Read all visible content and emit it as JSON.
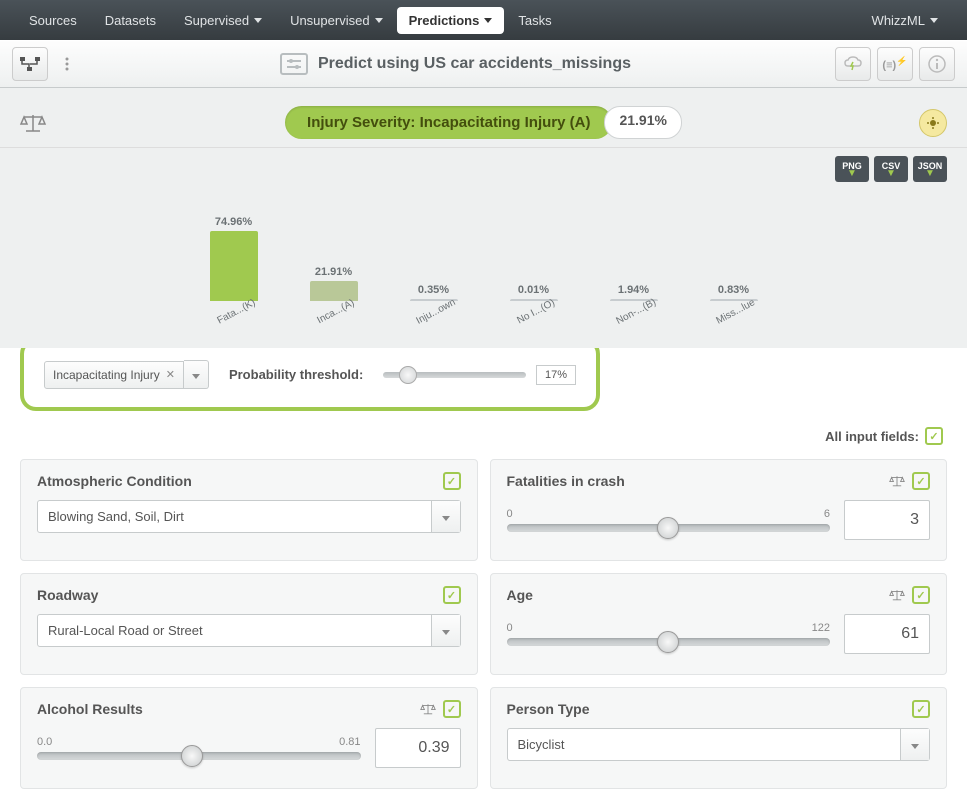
{
  "nav": {
    "items": [
      "Sources",
      "Datasets",
      "Supervised",
      "Unsupervised",
      "Predictions",
      "Tasks"
    ],
    "active": "Predictions",
    "right": "WhizzML"
  },
  "title": "Predict using US car accidents_missings",
  "prediction": {
    "label": "Injury Severity: Incapacitating Injury (A)",
    "pct": "21.91%"
  },
  "export_buttons": [
    "PNG",
    "CSV",
    "JSON"
  ],
  "chart_data": {
    "type": "bar",
    "categories": [
      "Fata...(K)",
      "Inca...(A)",
      "Inju...own",
      "No I...(O)",
      "Non-...(B)",
      "Miss...lue"
    ],
    "values": [
      74.96,
      21.91,
      0.35,
      0.01,
      1.94,
      0.83
    ],
    "labels": [
      "74.96%",
      "21.91%",
      "0.35%",
      "0.01%",
      "1.94%",
      "0.83%"
    ],
    "colors": [
      "#a0c94f",
      "#b9c898",
      "#c7cccf",
      "#c7cccf",
      "#c7cccf",
      "#c7cccf"
    ],
    "ylabel": "",
    "ylim": [
      0,
      100
    ]
  },
  "threshold": {
    "class": "Incapacitating Injury",
    "label": "Probability threshold:",
    "pct": "17%",
    "slider_pos": 17
  },
  "all_input_fields": "All input fields:",
  "fields": [
    {
      "title": "Atmospheric Condition",
      "type": "select",
      "value": "Blowing Sand, Soil, Dirt",
      "show_scale": false
    },
    {
      "title": "Fatalities in crash",
      "type": "slider",
      "min": "0",
      "max": "6",
      "value": "3",
      "slider_pos": 50,
      "show_scale": true
    },
    {
      "title": "Roadway",
      "type": "select",
      "value": "Rural-Local Road or Street",
      "show_scale": false
    },
    {
      "title": "Age",
      "type": "slider",
      "min": "0",
      "max": "122",
      "value": "61",
      "slider_pos": 50,
      "show_scale": true
    },
    {
      "title": "Alcohol Results",
      "type": "slider",
      "min": "0.0",
      "max": "0.81",
      "value": "0.39",
      "slider_pos": 48,
      "show_scale": true
    },
    {
      "title": "Person Type",
      "type": "select",
      "value": "Bicyclist",
      "show_scale": false
    }
  ]
}
